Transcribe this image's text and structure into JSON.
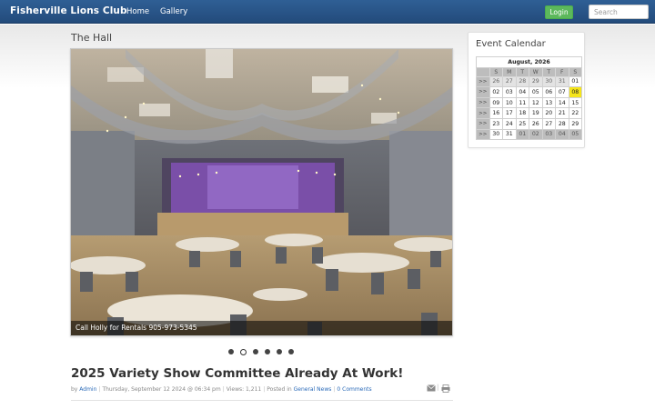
{
  "navbar": {
    "brand": "Fisherville Lions Club",
    "links": [
      "Home",
      "Gallery"
    ],
    "login_label": "Login",
    "search_placeholder": "Search"
  },
  "main": {
    "section_title": "The Hall",
    "slideshow": {
      "caption": "Call Holly for Rentals 905-973-5345",
      "slide_count": 6,
      "active_slide": 2
    },
    "article": {
      "title": "2025 Variety Show Committee Already At Work!",
      "by_label": "by",
      "author": "Admin",
      "date": "Thursday, September 12 2024 @ 06:34 pm",
      "views_label": "Views: 1,211",
      "posted_label": "Posted in",
      "category": "General News",
      "comments": "0 Comments",
      "tools": [
        "mail-icon",
        "print-icon"
      ]
    }
  },
  "calendar": {
    "title": "Event Calendar",
    "month_label": "August, 2026",
    "week_link": ">>",
    "weekdays": [
      "S",
      "M",
      "T",
      "W",
      "T",
      "F",
      "S"
    ],
    "weeks": [
      [
        "26",
        "27",
        "28",
        "29",
        "30",
        "31",
        "01"
      ],
      [
        "02",
        "03",
        "04",
        "05",
        "06",
        "07",
        "08"
      ],
      [
        "09",
        "10",
        "11",
        "12",
        "13",
        "14",
        "15"
      ],
      [
        "16",
        "17",
        "18",
        "19",
        "20",
        "21",
        "22"
      ],
      [
        "23",
        "24",
        "25",
        "26",
        "27",
        "28",
        "29"
      ],
      [
        "30",
        "31",
        "01",
        "02",
        "03",
        "04",
        "05"
      ]
    ],
    "today": "08",
    "colors": {
      "today": "#f5e51a",
      "header": "#bdbdbd"
    }
  },
  "colors": {
    "navbar": "#2f5f95",
    "login_button": "#5cb85c",
    "link": "#2a6ab8"
  }
}
